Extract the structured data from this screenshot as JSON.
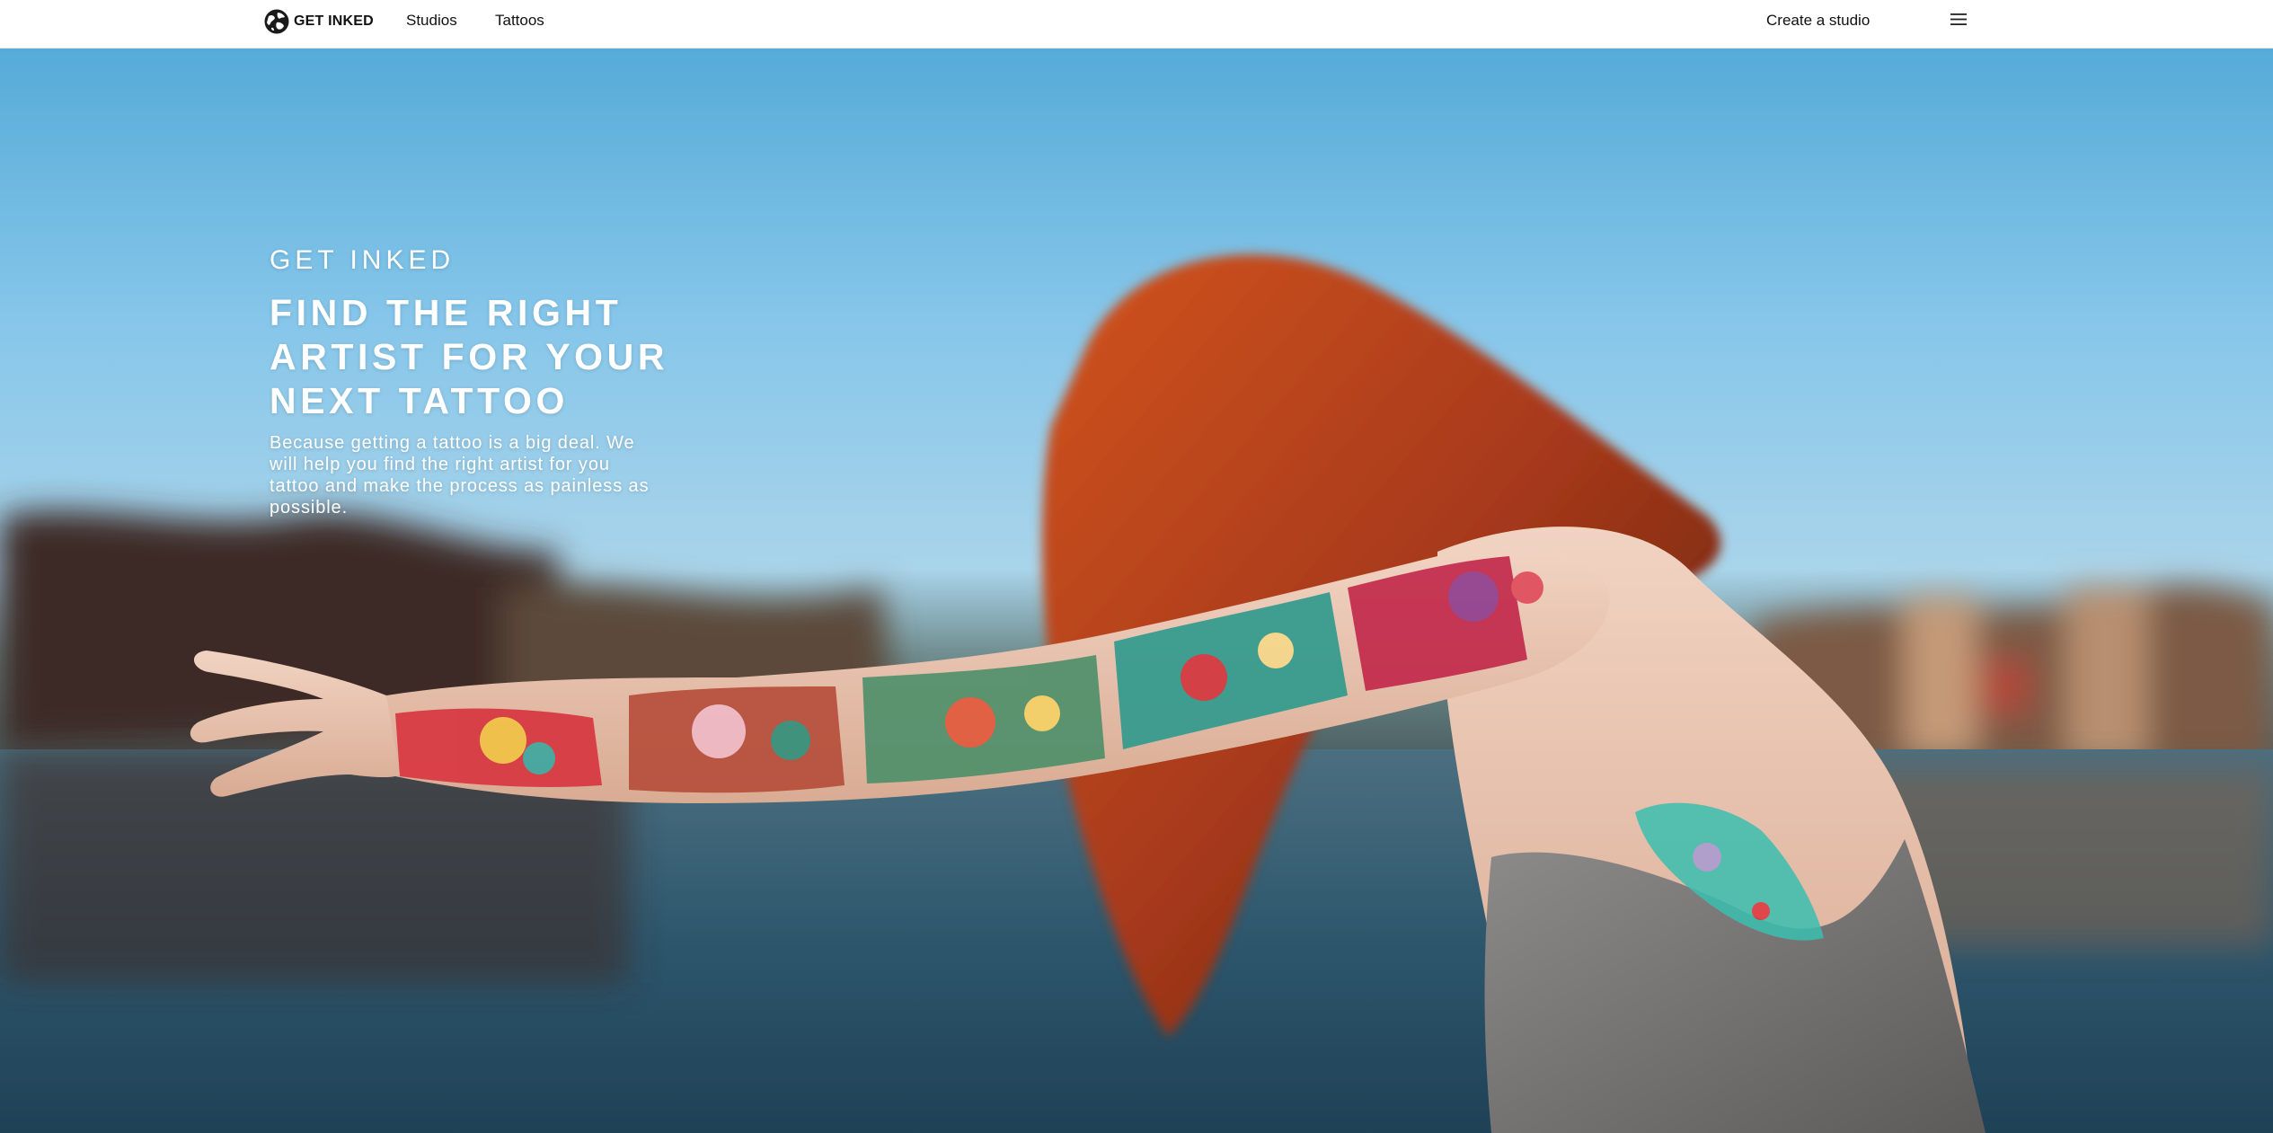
{
  "header": {
    "brand_name": "GET INKED",
    "nav": {
      "studios": "Studios",
      "tattoos": "Tattoos",
      "create_studio": "Create a studio"
    },
    "icons": {
      "logo": "globe-logo-icon",
      "menu": "hamburger-menu-icon"
    }
  },
  "hero": {
    "eyebrow": "GET INKED",
    "heading": "FIND THE RIGHT ARTIST FOR YOUR NEXT TATTOO",
    "body": "Because getting a tattoo is a big deal. We will help you find the right artist for you tattoo and make the process as painless as possible.",
    "background_image": "photo of a red-haired woman with a fully tattooed arm outstretched over a blurred lake"
  },
  "colors": {
    "nav_background": "#ffffff",
    "nav_text": "#111111",
    "hero_text": "#ffffff",
    "sky_top": "#4fa9d9",
    "sky_light": "#9ccfec",
    "water": "#2b4f66",
    "hair": "#b9461c"
  }
}
